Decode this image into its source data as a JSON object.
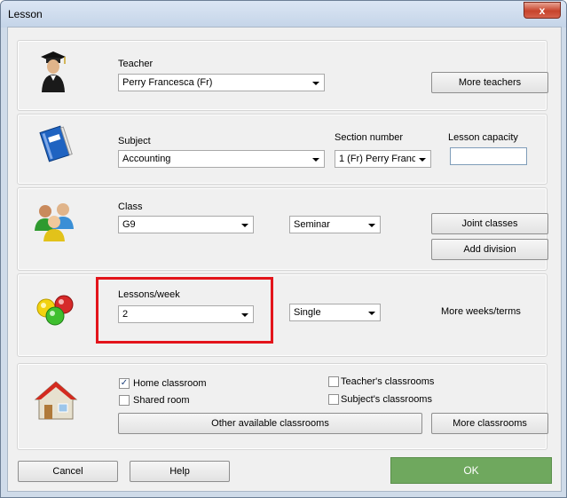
{
  "window": {
    "title": "Lesson",
    "close_glyph": "x"
  },
  "teacher": {
    "label": "Teacher",
    "value": "Perry Francesca (Fr)",
    "more_button": "More teachers",
    "icon": "teacher-icon"
  },
  "subject": {
    "label": "Subject",
    "value": "Accounting",
    "section_label": "Section number",
    "section_value": "1 (Fr) Perry Franc",
    "capacity_label": "Lesson capacity",
    "capacity_value": "",
    "icon": "book-icon"
  },
  "class": {
    "label": "Class",
    "value": "G9",
    "type_value": "Seminar",
    "joint_button": "Joint classes",
    "division_button": "Add division",
    "icon": "students-icon"
  },
  "lessons": {
    "label": "Lessons/week",
    "value": "2",
    "length_value": "Single",
    "more_weeks": "More weeks/terms",
    "icon": "balls-icon"
  },
  "classroom": {
    "home_label": "Home classroom",
    "home_checked": true,
    "shared_label": "Shared room",
    "shared_checked": false,
    "teachers_label": "Teacher's classrooms",
    "teachers_checked": false,
    "subjects_label": "Subject's classrooms",
    "subjects_checked": false,
    "other_button": "Other available classrooms",
    "more_button": "More classrooms",
    "icon": "house-icon"
  },
  "footer": {
    "cancel": "Cancel",
    "help": "Help",
    "ok": "OK"
  },
  "colors": {
    "ok_green": "#6fa85e",
    "highlight_red": "#e3141b"
  }
}
